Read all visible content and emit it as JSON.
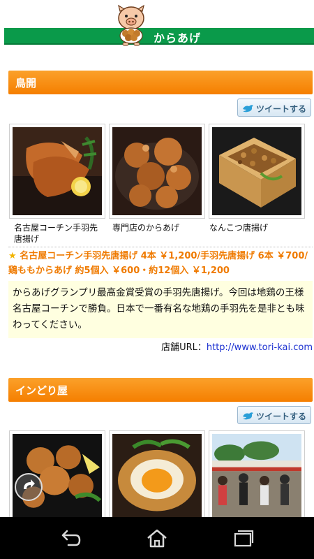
{
  "header": {
    "title": "からあげ"
  },
  "sections": [
    {
      "name": "鳥開",
      "tweet_label": "ツイートする",
      "items": [
        {
          "caption": "名古屋コーチン手羽先唐揚げ"
        },
        {
          "caption": "専門店のからあげ"
        },
        {
          "caption": "なんこつ唐揚げ"
        }
      ],
      "price_text": "名古屋コーチン手羽先唐揚げ 4本 ￥1,200/手羽先唐揚げ 6本 ￥700/鶏ももからあげ 約5個入 ￥600・約12個入 ￥1,200",
      "description": "からあげグランプリ最高金賞受賞の手羽先唐揚げ。今回は地鶏の王様名古屋コーチンで勝負。日本で一番有名な地鶏の手羽先を是非とも味わってください。",
      "url_label": "店舗URL：",
      "url": "http://www.tori-kai.com"
    },
    {
      "name": "インどり屋",
      "tweet_label": "ツイートする"
    }
  ],
  "navbar": {
    "icons": [
      "back-icon",
      "home-icon",
      "recent-apps-icon"
    ]
  },
  "colors": {
    "green": "#0a9a4a",
    "orange": "#f57f00",
    "link": "#1a2fd0"
  }
}
